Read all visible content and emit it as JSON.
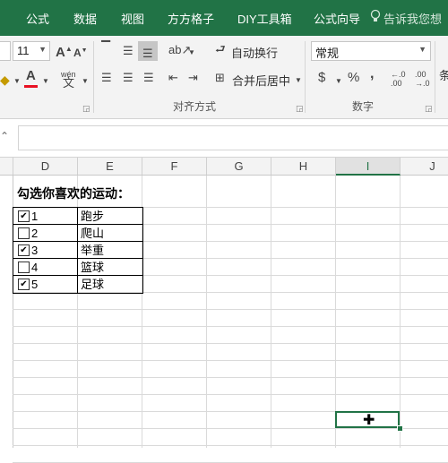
{
  "tabs": [
    "公式",
    "数据",
    "视图",
    "方方格子",
    "DIY工具箱",
    "公式向导"
  ],
  "tell_me": "告诉我您想",
  "ribbon": {
    "font_size": "11",
    "wrap_text": "自动换行",
    "merge_center": "合并后居中",
    "number_format": "常规",
    "align_group": "对齐方式",
    "number_group": "数字",
    "pinyin": "wén",
    "percent": "%",
    "comma": ",",
    "currency": "$",
    "inc_decimal": "←.0\n.00",
    "dec_decimal": ".00\n→.0",
    "cond_label": "条"
  },
  "formula_bar": {
    "name_box": "",
    "formula": ""
  },
  "columns": [
    "D",
    "E",
    "F",
    "G",
    "H",
    "I",
    "J"
  ],
  "selected_column": "I",
  "sheet": {
    "title": "勾选你喜欢的运动：",
    "rows": [
      {
        "num": "1",
        "checked": true,
        "sport": "跑步"
      },
      {
        "num": "2",
        "checked": false,
        "sport": "爬山"
      },
      {
        "num": "3",
        "checked": true,
        "sport": "举重"
      },
      {
        "num": "4",
        "checked": false,
        "sport": "篮球"
      },
      {
        "num": "5",
        "checked": true,
        "sport": "足球"
      }
    ]
  },
  "colors": {
    "brand": "#217346",
    "grid": "#dadada"
  }
}
